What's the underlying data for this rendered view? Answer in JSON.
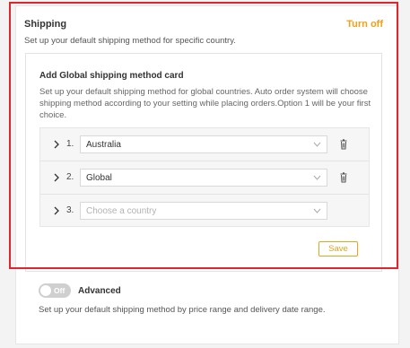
{
  "shipping": {
    "title": "Shipping",
    "turn_off": "Turn off",
    "description": "Set up your default shipping method for specific country."
  },
  "card": {
    "title": "Add Global shipping method card",
    "description": "Set up your default shipping method for global countries. Auto order system will choose shipping method according to your setting while placing orders.Option 1 will be your first choice.",
    "rows": [
      {
        "number": "1.",
        "value": "Australia"
      },
      {
        "number": "2.",
        "value": "Global"
      },
      {
        "number": "3.",
        "placeholder": "Choose a country"
      }
    ],
    "save_label": "Save"
  },
  "advanced": {
    "toggle_label": "Off",
    "label": "Advanced",
    "description": "Set up your default shipping method by price range and delivery date range."
  },
  "colors": {
    "accent": "#f0a01a",
    "highlight_border": "#e0262d"
  },
  "icons": [
    "chevron-right-icon",
    "chevron-down-icon",
    "trash-icon"
  ]
}
